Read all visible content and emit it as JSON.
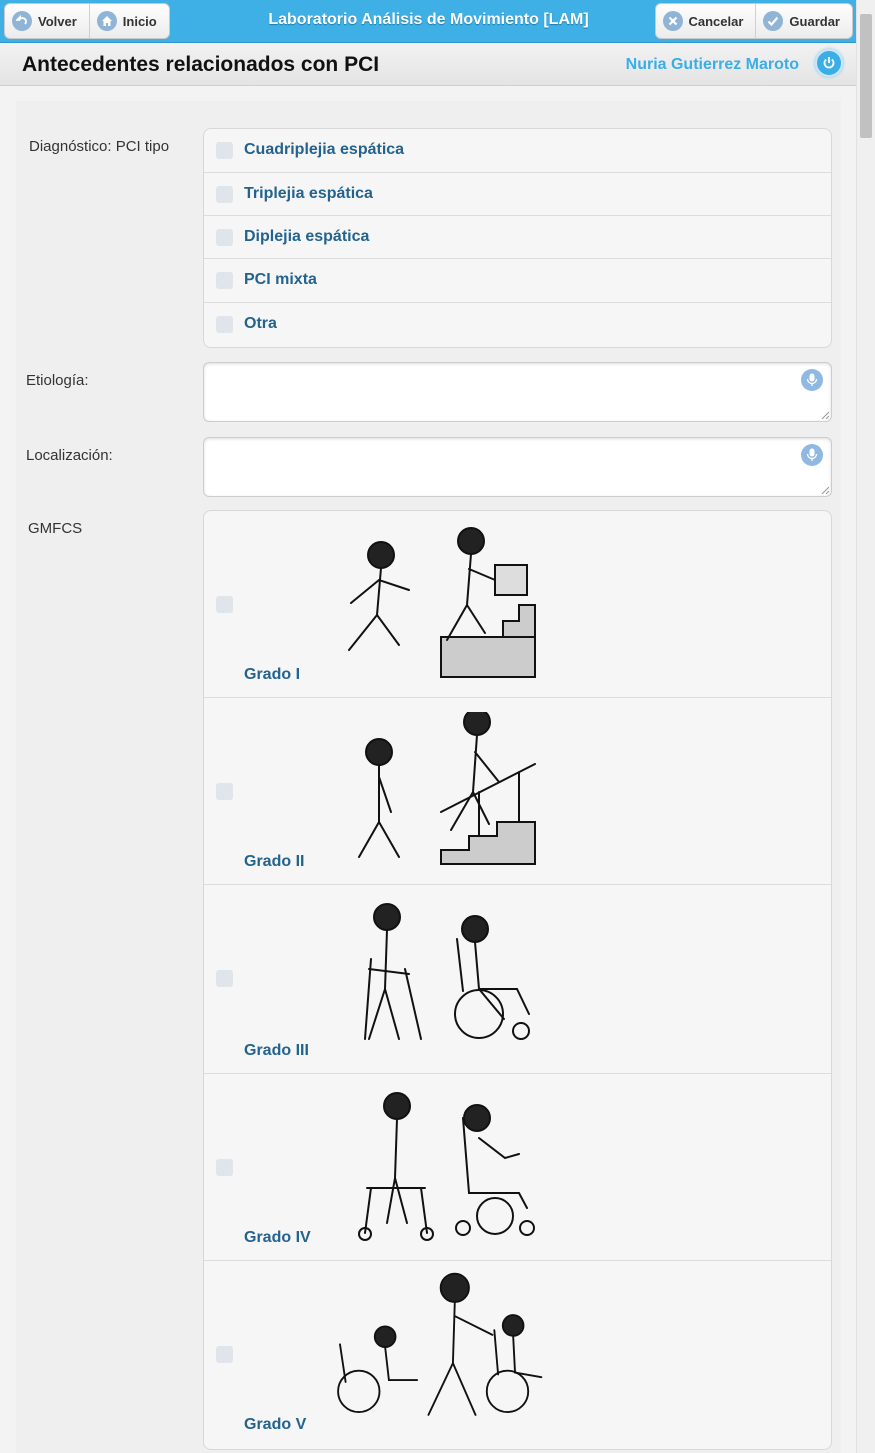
{
  "header": {
    "back_label": "Volver",
    "home_label": "Inicio",
    "app_title": "Laboratorio Análisis de Movimiento [LAM]",
    "cancel_label": "Cancelar",
    "save_label": "Guardar"
  },
  "subheader": {
    "page_title": "Antecedentes relacionados con PCI",
    "user_name": "Nuria Gutierrez Maroto"
  },
  "form": {
    "diagnosis": {
      "label": "Diagnóstico: PCI tipo",
      "options": [
        "Cuadriplejia espática",
        "Triplejia espática",
        "Diplejia espática",
        "PCI mixta",
        "Otra"
      ]
    },
    "etiology": {
      "label": "Etiología:",
      "value": ""
    },
    "location": {
      "label": "Localización:",
      "value": ""
    },
    "gmfcs": {
      "label": "GMFCS",
      "options": [
        {
          "label": "Grado I",
          "illustration": "child-walking-and-climbing-stairs-carrying-box"
        },
        {
          "label": "Grado II",
          "illustration": "child-walking-and-climbing-stairs-with-rail"
        },
        {
          "label": "Grado III",
          "illustration": "child-with-crutches-and-child-in-wheelchair"
        },
        {
          "label": "Grado IV",
          "illustration": "child-with-walker-and-child-in-power-wheelchair"
        },
        {
          "label": "Grado V",
          "illustration": "children-in-wheelchairs-pushed-by-adult"
        }
      ]
    }
  },
  "colors": {
    "header_bg": "#3fb0e6",
    "option_text": "#24638e",
    "user_name": "#3aaee7"
  },
  "icons": [
    "back-icon",
    "home-icon",
    "cancel-icon",
    "save-icon",
    "power-icon",
    "microphone-icon"
  ]
}
